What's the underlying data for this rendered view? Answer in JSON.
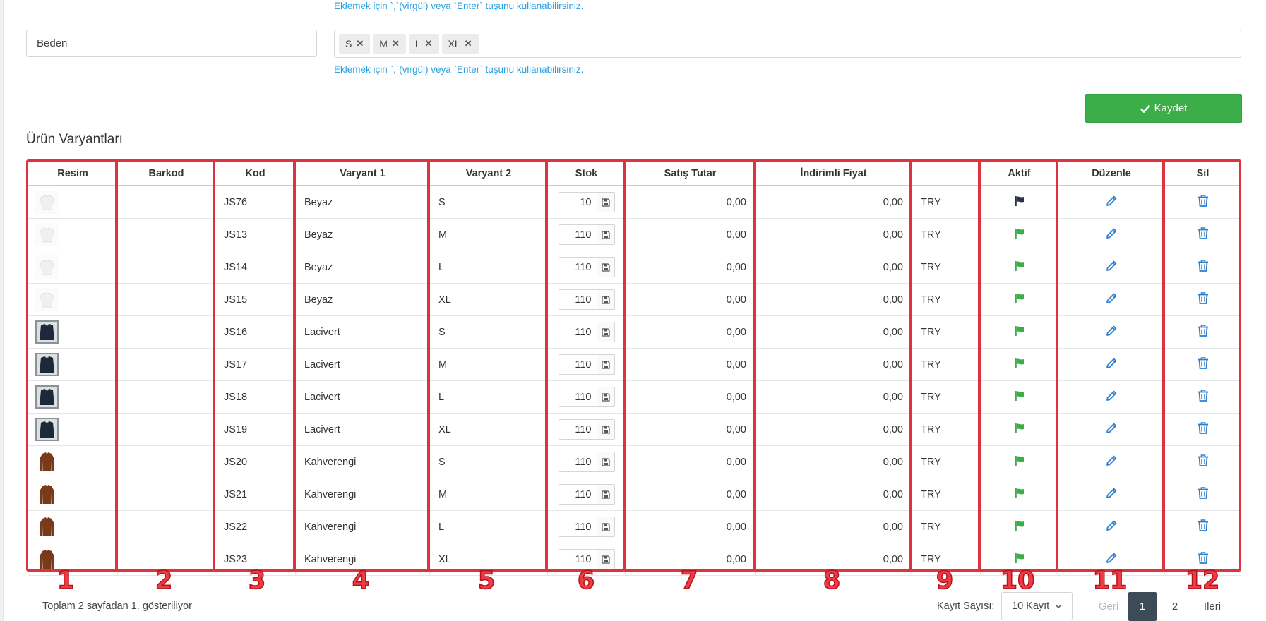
{
  "hints": {
    "top": "Eklemek için `,`(virgül) veya `Enter` tuşunu kullanabilirsiniz.",
    "mid": "Eklemek için `,`(virgül) veya `Enter` tuşunu kullanabilirsiniz."
  },
  "attribute": {
    "name": "Beden",
    "tags": [
      "S",
      "M",
      "L",
      "XL"
    ],
    "tag_remove": "✕"
  },
  "save_button": {
    "label": "Kaydet"
  },
  "section_title": "Ürün Varyantları",
  "table": {
    "headers": [
      "Resim",
      "Barkod",
      "Kod",
      "Varyant 1",
      "Varyant 2",
      "Stok",
      "Satış Tutar",
      "İndirimli Fiyat",
      "",
      "Aktif",
      "Düzenle",
      "Sil"
    ],
    "rows": [
      {
        "img": "white-shirt",
        "barkod": "",
        "kod": "JS76",
        "v1": "Beyaz",
        "v2": "S",
        "stok": "10",
        "satis": "0,00",
        "indirimli": "0,00",
        "currency": "TRY",
        "active": false
      },
      {
        "img": "white-shirt",
        "barkod": "",
        "kod": "JS13",
        "v1": "Beyaz",
        "v2": "M",
        "stok": "110",
        "satis": "0,00",
        "indirimli": "0,00",
        "currency": "TRY",
        "active": true
      },
      {
        "img": "white-shirt",
        "barkod": "",
        "kod": "JS14",
        "v1": "Beyaz",
        "v2": "L",
        "stok": "110",
        "satis": "0,00",
        "indirimli": "0,00",
        "currency": "TRY",
        "active": true
      },
      {
        "img": "white-shirt",
        "barkod": "",
        "kod": "JS15",
        "v1": "Beyaz",
        "v2": "XL",
        "stok": "110",
        "satis": "0,00",
        "indirimli": "0,00",
        "currency": "TRY",
        "active": true
      },
      {
        "img": "navy-shirt",
        "barkod": "",
        "kod": "JS16",
        "v1": "Lacivert",
        "v2": "S",
        "stok": "110",
        "satis": "0,00",
        "indirimli": "0,00",
        "currency": "TRY",
        "active": true
      },
      {
        "img": "navy-shirt",
        "barkod": "",
        "kod": "JS17",
        "v1": "Lacivert",
        "v2": "M",
        "stok": "110",
        "satis": "0,00",
        "indirimli": "0,00",
        "currency": "TRY",
        "active": true
      },
      {
        "img": "navy-shirt",
        "barkod": "",
        "kod": "JS18",
        "v1": "Lacivert",
        "v2": "L",
        "stok": "110",
        "satis": "0,00",
        "indirimli": "0,00",
        "currency": "TRY",
        "active": true
      },
      {
        "img": "navy-shirt",
        "barkod": "",
        "kod": "JS19",
        "v1": "Lacivert",
        "v2": "XL",
        "stok": "110",
        "satis": "0,00",
        "indirimli": "0,00",
        "currency": "TRY",
        "active": true
      },
      {
        "img": "brown-jacket",
        "barkod": "",
        "kod": "JS20",
        "v1": "Kahverengi",
        "v2": "S",
        "stok": "110",
        "satis": "0,00",
        "indirimli": "0,00",
        "currency": "TRY",
        "active": true
      },
      {
        "img": "brown-jacket",
        "barkod": "",
        "kod": "JS21",
        "v1": "Kahverengi",
        "v2": "M",
        "stok": "110",
        "satis": "0,00",
        "indirimli": "0,00",
        "currency": "TRY",
        "active": true
      },
      {
        "img": "brown-jacket",
        "barkod": "",
        "kod": "JS22",
        "v1": "Kahverengi",
        "v2": "L",
        "stok": "110",
        "satis": "0,00",
        "indirimli": "0,00",
        "currency": "TRY",
        "active": true
      },
      {
        "img": "brown-jacket",
        "barkod": "",
        "kod": "JS23",
        "v1": "Kahverengi",
        "v2": "XL",
        "stok": "110",
        "satis": "0,00",
        "indirimli": "0,00",
        "currency": "TRY",
        "active": true
      }
    ]
  },
  "annotations": [
    "1",
    "2",
    "3",
    "4",
    "5",
    "6",
    "7",
    "8",
    "9",
    "10",
    "11",
    "12"
  ],
  "footer": {
    "info": "Toplam 2 sayfadan 1. gösteriliyor",
    "per_page_label": "Kayıt Sayısı:",
    "per_page_value": "10 Kayıt",
    "prev": "Geri",
    "pages": [
      "1",
      "2"
    ],
    "next": "İleri"
  },
  "colors": {
    "accent_blue": "#2f7fd0",
    "save_green": "#3cae49",
    "flag_green": "#3cae49",
    "flag_dark": "#2b3440",
    "annotation_red": "#e0323e"
  },
  "icons": {
    "save": "check-icon",
    "stock_save": "floppy-icon",
    "active": "flag-icon",
    "edit": "pencil-icon",
    "delete": "trash-icon",
    "select": "chevron-down-icon"
  }
}
